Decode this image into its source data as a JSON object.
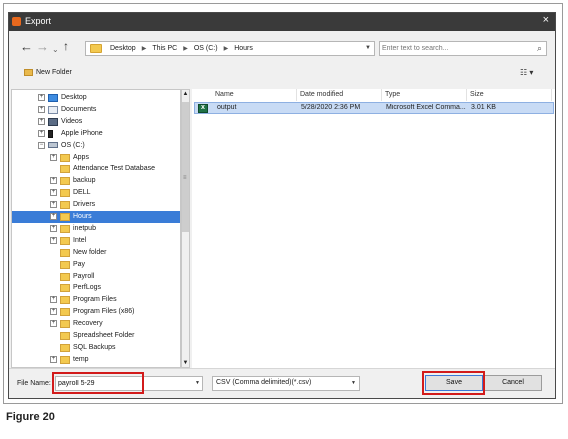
{
  "window": {
    "title": "Export"
  },
  "address": {
    "crumbs": [
      "Desktop",
      "This PC",
      "OS (C:)",
      "Hours"
    ]
  },
  "search": {
    "placeholder": "Enter text to search..."
  },
  "toolbar": {
    "new_folder": "New Folder"
  },
  "tree": [
    {
      "label": "Desktop",
      "icon": "desktop-icon",
      "level": 0,
      "expander": "+"
    },
    {
      "label": "Documents",
      "icon": "documents-icon",
      "level": 0,
      "expander": "+"
    },
    {
      "label": "Videos",
      "icon": "videos-icon",
      "level": 0,
      "expander": "+"
    },
    {
      "label": "Apple iPhone",
      "icon": "phone-icon",
      "level": 0,
      "expander": "+"
    },
    {
      "label": "OS (C:)",
      "icon": "drive-icon",
      "level": 0,
      "expander": "-"
    },
    {
      "label": "Apps",
      "icon": "folder-icon",
      "level": 1,
      "expander": "+"
    },
    {
      "label": "Attendance Test Database",
      "icon": "folder-icon",
      "level": 1,
      "expander": ""
    },
    {
      "label": "backup",
      "icon": "folder-icon",
      "level": 1,
      "expander": "+"
    },
    {
      "label": "DELL",
      "icon": "folder-icon",
      "level": 1,
      "expander": "+"
    },
    {
      "label": "Drivers",
      "icon": "folder-icon",
      "level": 1,
      "expander": "+"
    },
    {
      "label": "Hours",
      "icon": "folder-icon",
      "level": 1,
      "expander": "+",
      "selected": true
    },
    {
      "label": "inetpub",
      "icon": "folder-icon",
      "level": 1,
      "expander": "+"
    },
    {
      "label": "Intel",
      "icon": "folder-icon",
      "level": 1,
      "expander": "+"
    },
    {
      "label": "New folder",
      "icon": "folder-icon",
      "level": 1,
      "expander": ""
    },
    {
      "label": "Pay",
      "icon": "folder-icon",
      "level": 1,
      "expander": ""
    },
    {
      "label": "Payroll",
      "icon": "folder-icon",
      "level": 1,
      "expander": ""
    },
    {
      "label": "PerfLogs",
      "icon": "folder-icon",
      "level": 1,
      "expander": ""
    },
    {
      "label": "Program Files",
      "icon": "folder-icon",
      "level": 1,
      "expander": "+"
    },
    {
      "label": "Program Files (x86)",
      "icon": "folder-icon",
      "level": 1,
      "expander": "+"
    },
    {
      "label": "Recovery",
      "icon": "folder-icon",
      "level": 1,
      "expander": "+"
    },
    {
      "label": "Spreadsheet Folder",
      "icon": "folder-icon",
      "level": 1,
      "expander": ""
    },
    {
      "label": "SQL Backups",
      "icon": "folder-icon",
      "level": 1,
      "expander": ""
    },
    {
      "label": "temp",
      "icon": "folder-icon",
      "level": 1,
      "expander": "+"
    }
  ],
  "columns": [
    "Name",
    "Date modified",
    "Type",
    "Size"
  ],
  "files": [
    {
      "name": "output",
      "date": "5/28/2020 2:36 PM",
      "type": "Microsoft Excel Comma...",
      "size": "3.01 KB",
      "icon": "excel-csv-icon"
    }
  ],
  "bottom": {
    "file_name_label": "File Name:",
    "file_name_value": "payroll 5-29",
    "file_type": "CSV (Comma delimited)(*.csv)",
    "save_label": "Save",
    "cancel_label": "Cancel",
    "highlight_color": "#d21b1b"
  },
  "caption": "Figure 20"
}
